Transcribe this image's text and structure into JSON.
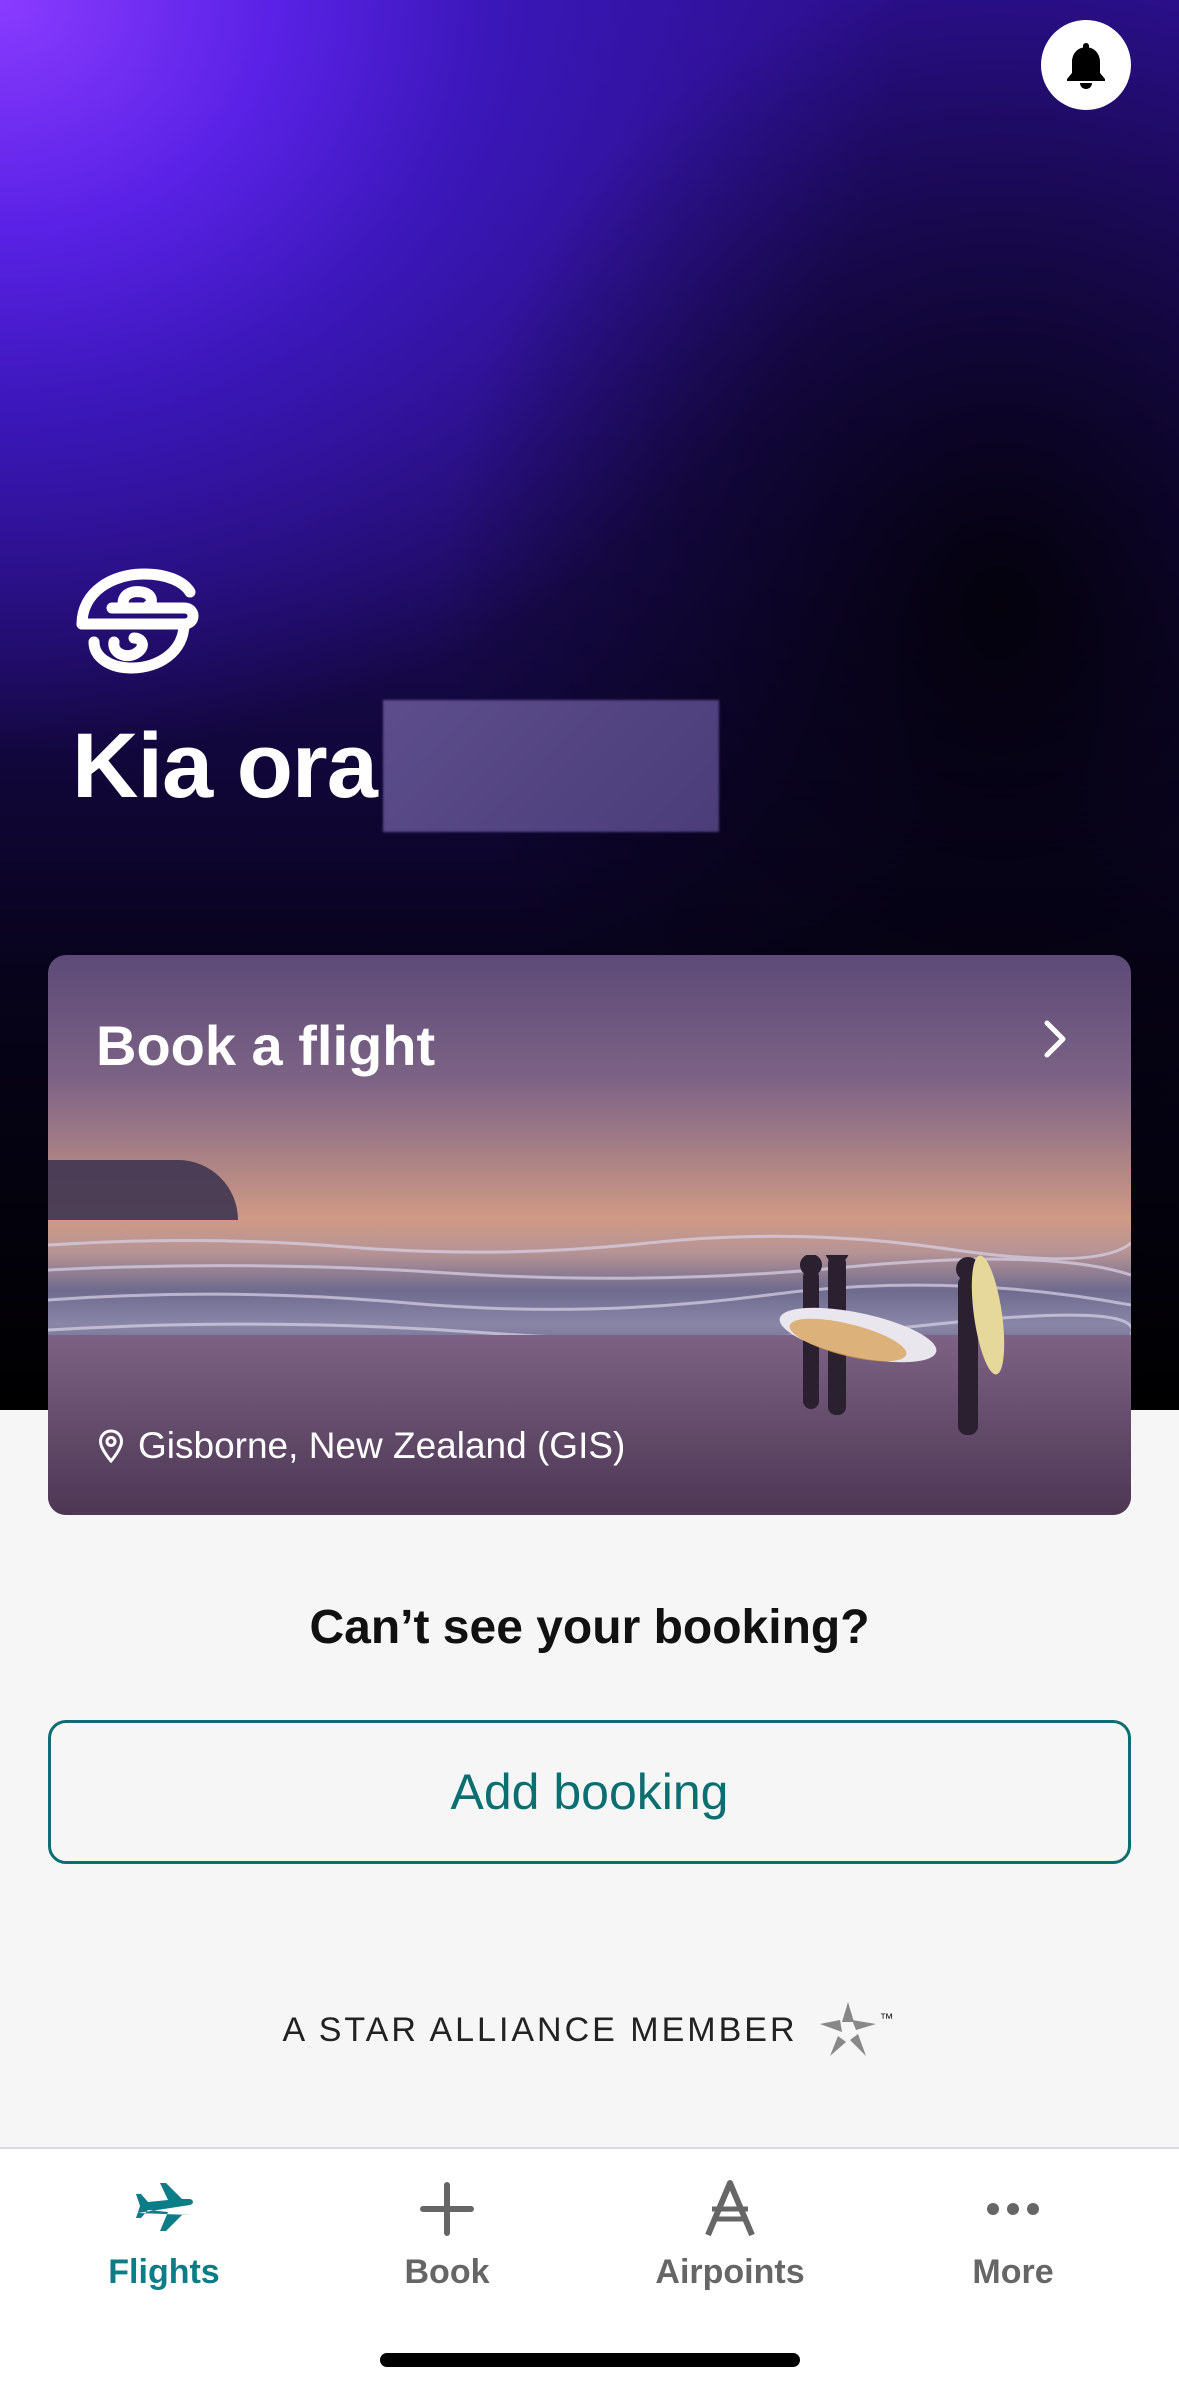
{
  "header": {
    "greeting": "Kia ora",
    "notification_icon": "bell-icon"
  },
  "book_card": {
    "title": "Book a flight",
    "location": "Gisborne, New Zealand (GIS)"
  },
  "booking_prompt": {
    "question": "Can’t see your booking?",
    "button_label": "Add booking"
  },
  "footer": {
    "alliance_text": "A STAR ALLIANCE MEMBER",
    "alliance_tm": "™"
  },
  "tabs": [
    {
      "label": "Flights",
      "icon": "plane-icon",
      "active": true
    },
    {
      "label": "Book",
      "icon": "plus-icon",
      "active": false
    },
    {
      "label": "Airpoints",
      "icon": "airpoints-icon",
      "active": false
    },
    {
      "label": "More",
      "icon": "more-icon",
      "active": false
    }
  ],
  "colors": {
    "accent": "#0b7d86",
    "button_border": "#0b6e70",
    "hero_purple": "#8a3cff"
  }
}
